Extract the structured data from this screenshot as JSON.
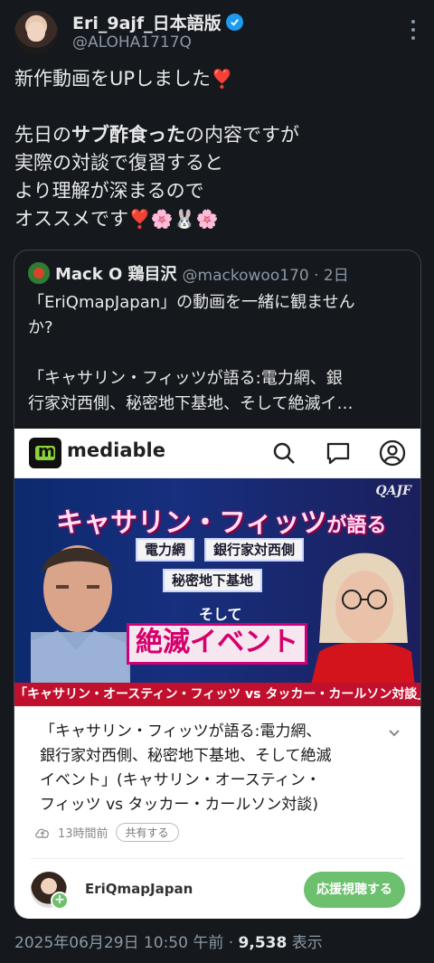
{
  "author": {
    "display_name": "Eri_9ajf_日本語版",
    "handle": "@ALOHA1717Q",
    "verified": true
  },
  "tweet": {
    "line1": "新作動画をUPしました",
    "line1_emoji": "❣️",
    "line3_a": "先日の",
    "line3_bold": "サブ酢食った",
    "line3_b": "の内容ですが",
    "line4": "実際の対談で復習すると",
    "line5": "より理解が深まるので",
    "line6": "オススメです",
    "line6_emoji": "❣️🌸🐰🌸"
  },
  "quote": {
    "name": "Mack O 鶏目沢",
    "handle": "@mackowoo170 · 2日",
    "text_line1": "「EriQmapJapan」の動画を一緒に観ません",
    "text_line2": "か?",
    "text_line3": "「キャサリン・フィッツが語る:電力網、銀",
    "text_line4": "行家対西側、秘密地下基地、そして絶滅イ…"
  },
  "embed": {
    "site_name": "mediable",
    "thumbnail": {
      "tag": "QAJF",
      "title_main": "キャサリン・フィッツ",
      "title_suffix": "が語る",
      "pill1": "電力網",
      "pill2": "銀行家対西側",
      "pill3": "秘密地下基地",
      "soshite": "そして",
      "big": "絶滅イベント",
      "bottom": "「キャサリン・オースティン・フィッツ vs タッカー・カールソン対談」"
    },
    "description": {
      "line1": "「キャサリン・フィッツが語る:電力網、",
      "line2": "銀行家対西側、秘密地下基地、そして絶滅",
      "line3": "イベント」(キャサリン・オースティン・",
      "line4": "フィッツ vs タッカー・カールソン対談)"
    },
    "time_ago": "13時間前",
    "share_label": "共有する",
    "channel_name": "EriQmapJapan",
    "support_button": "応援視聴する"
  },
  "timestamp": {
    "datetime": "2025年06月29日 10:50 午前 · ",
    "views": "9,538",
    "views_label": " 表示"
  },
  "colors": {
    "background": "#15181c",
    "verified": "#1d9bf0",
    "support_button": "#6cc06e",
    "heart": "#f4245e"
  }
}
